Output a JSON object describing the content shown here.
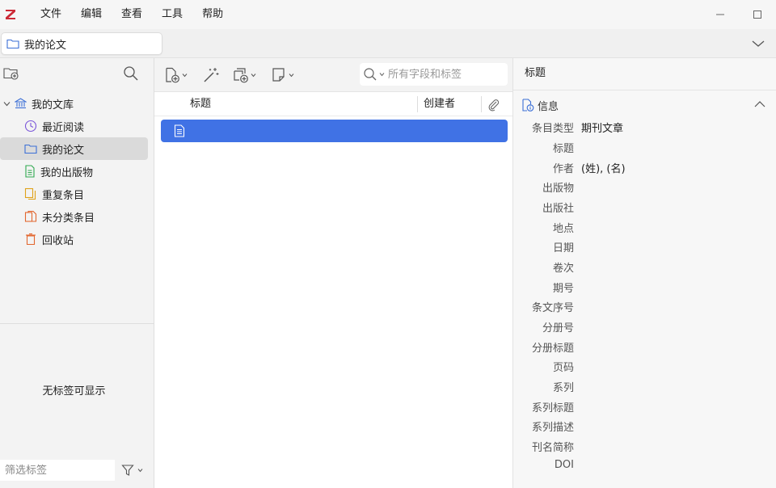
{
  "menubar": {
    "items": [
      "文件",
      "编辑",
      "查看",
      "工具",
      "帮助"
    ]
  },
  "tab": {
    "label": "我的论文"
  },
  "collections": {
    "library": "我的文库",
    "items": [
      {
        "label": "最近阅读"
      },
      {
        "label": "我的论文"
      },
      {
        "label": "我的出版物"
      },
      {
        "label": "重复条目"
      },
      {
        "label": "未分类条目"
      },
      {
        "label": "回收站"
      }
    ]
  },
  "tags": {
    "empty_text": "无标签可显示",
    "filter_placeholder": "筛选标签"
  },
  "search": {
    "placeholder": "所有字段和标签"
  },
  "columns": {
    "title": "标题",
    "creator": "创建者"
  },
  "item_pane": {
    "header": "标题",
    "section": "信息",
    "fields": [
      {
        "label": "条目类型",
        "value": "期刊文章"
      },
      {
        "label": "标题",
        "value": ""
      },
      {
        "label": "作者",
        "value": "(姓), (名)"
      },
      {
        "label": "出版物",
        "value": ""
      },
      {
        "label": "出版社",
        "value": ""
      },
      {
        "label": "地点",
        "value": ""
      },
      {
        "label": "日期",
        "value": ""
      },
      {
        "label": "卷次",
        "value": ""
      },
      {
        "label": "期号",
        "value": ""
      },
      {
        "label": "条文序号",
        "value": ""
      },
      {
        "label": "分册号",
        "value": ""
      },
      {
        "label": "分册标题",
        "value": ""
      },
      {
        "label": "页码",
        "value": ""
      },
      {
        "label": "系列",
        "value": ""
      },
      {
        "label": "系列标题",
        "value": ""
      },
      {
        "label": "系列描述",
        "value": ""
      },
      {
        "label": "刊名简称",
        "value": ""
      },
      {
        "label": "DOI",
        "value": ""
      }
    ]
  },
  "colors": {
    "accent": "#4072e5",
    "logo": "#cc2936"
  }
}
